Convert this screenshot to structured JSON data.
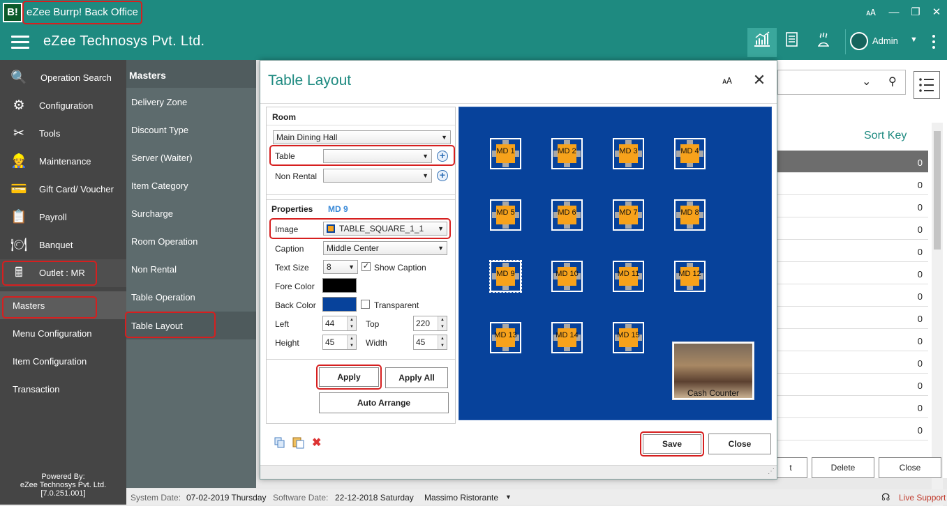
{
  "window": {
    "app_icon_text": "B!",
    "title": "eZee Burrp! Back Office",
    "min": "—",
    "restore": "❐",
    "close": "✕",
    "translate": "🗚"
  },
  "header": {
    "company": "eZee Technosys Pvt. Ltd.",
    "user": "Admin",
    "icons": [
      "chart-icon",
      "reports-icon",
      "kitchen-icon"
    ]
  },
  "sidebar": {
    "items": [
      {
        "label": "Operation Search",
        "icon": "search-icon",
        "glyph": "🔍"
      },
      {
        "label": "Configuration",
        "icon": "gear-icon",
        "glyph": "⚙"
      },
      {
        "label": "Tools",
        "icon": "tools-icon",
        "glyph": "✂"
      },
      {
        "label": "Maintenance",
        "icon": "maintenance-icon",
        "glyph": "👷"
      },
      {
        "label": "Gift Card/ Voucher",
        "icon": "gift-card-icon",
        "glyph": "💳"
      },
      {
        "label": "Payroll",
        "icon": "payroll-icon",
        "glyph": "📋"
      },
      {
        "label": "Banquet",
        "icon": "banquet-icon",
        "glyph": "🍽"
      },
      {
        "label": "Outlet : MR",
        "icon": "cash-register-icon",
        "glyph": "🖩"
      }
    ],
    "sub": [
      "Masters",
      "Menu Configuration",
      "Item Configuration",
      "Transaction"
    ],
    "powered_by": "Powered By:",
    "powered_company": "eZee Technosys Pvt. Ltd.",
    "version": "[7.0.251.001]"
  },
  "submenu": {
    "title": "Masters",
    "items": [
      "Delivery Zone",
      "Discount Type",
      "Server (Waiter)",
      "Item Category",
      "Surcharge",
      "Room Operation",
      "Non Rental",
      "Table Operation",
      "Table Layout"
    ]
  },
  "background_list": {
    "header": "Sort Key",
    "values": [
      "0",
      "0",
      "0",
      "0",
      "0",
      "0",
      "0",
      "0",
      "0",
      "0",
      "0",
      "0",
      "0"
    ],
    "buttons": [
      "t",
      "Delete",
      "Close"
    ]
  },
  "status": {
    "system_date_label": "System Date:",
    "system_date": "07-02-2019 Thursday",
    "software_date_label": "Software Date:",
    "software_date": "22-12-2018 Saturday",
    "outlet": "Massimo Ristorante",
    "support": "Live Support"
  },
  "dialog": {
    "title": "Table Layout",
    "room": {
      "section_label": "Room",
      "room_value": "Main Dining Hall",
      "table_label": "Table",
      "table_value": "",
      "nonrental_label": "Non Rental",
      "nonrental_value": ""
    },
    "properties": {
      "section_label": "Properties",
      "selected": "MD 9",
      "image_label": "Image",
      "image_value": "TABLE_SQUARE_1_1",
      "caption_label": "Caption",
      "caption_value": "Middle Center",
      "textsize_label": "Text Size",
      "textsize_value": "8",
      "show_caption_label": "Show Caption",
      "show_caption_checked": true,
      "fore_color_label": "Fore Color",
      "fore_color": "#000000",
      "back_color_label": "Back Color",
      "back_color": "#07429b",
      "transparent_label": "Transparent",
      "transparent_checked": false,
      "left_label": "Left",
      "left_value": "44",
      "top_label": "Top",
      "top_value": "220",
      "height_label": "Height",
      "height_value": "45",
      "width_label": "Width",
      "width_value": "45"
    },
    "buttons": {
      "apply": "Apply",
      "apply_all": "Apply All",
      "auto_arrange": "Auto Arrange",
      "save": "Save",
      "close": "Close"
    },
    "tables": [
      "MD 1",
      "MD 2",
      "MD 3",
      "MD 4",
      "MD 5",
      "MD 6",
      "MD 7",
      "MD 8",
      "MD 9",
      "MD 10",
      "MD 11",
      "MD 12",
      "MD 13",
      "MD 14",
      "MD 15"
    ],
    "cash_counter": "Cash Counter",
    "canvas_color": "#07429b",
    "table_color": "#f7a21b"
  },
  "accent": "#1e8a80"
}
